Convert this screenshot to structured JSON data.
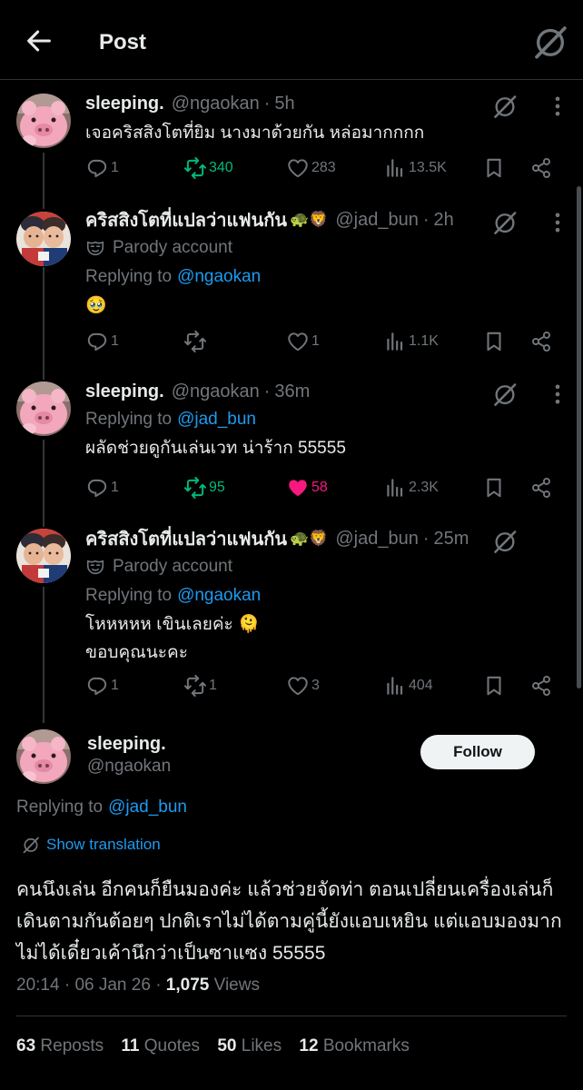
{
  "header": {
    "title": "Post"
  },
  "thread": [
    {
      "avatar": "pink-plush-avatar",
      "name": "sleeping.",
      "handle": "@ngaokan",
      "time": "5h",
      "parody": "",
      "replying_to_label": "",
      "replying_to": "",
      "text": "เจอคริสสิงโตที่ยิม นางมาด้วยกัน หล่อมากกกก",
      "replies": "1",
      "reposts": "340",
      "likes": "283",
      "views": "13.5K",
      "reposted": true,
      "liked": false
    },
    {
      "avatar": "couple-photo-avatar",
      "name": "คริสสิงโตที่แปลว่าแฟนกัน",
      "name_emoji": "🐢🦁",
      "handle": "@jad_bun",
      "time": "2h",
      "parody": "Parody account",
      "replying_to_label": "Replying to",
      "replying_to": "@ngaokan",
      "text": "🥹",
      "replies": "1",
      "reposts": "",
      "likes": "1",
      "views": "1.1K",
      "reposted": false,
      "liked": false
    },
    {
      "avatar": "pink-plush-avatar",
      "name": "sleeping.",
      "handle": "@ngaokan",
      "time": "36m",
      "parody": "",
      "replying_to_label": "Replying to",
      "replying_to": "@jad_bun",
      "text": "ผลัดช่วยดูกันเล่นเวท น่าร้าก 55555",
      "replies": "1",
      "reposts": "95",
      "likes": "58",
      "views": "2.3K",
      "reposted": true,
      "liked": true
    },
    {
      "avatar": "couple-photo-avatar",
      "name": "คริสสิงโตที่แปลว่าแฟนกัน",
      "name_emoji": "🐢🦁",
      "handle": "@jad_bun",
      "time": "25m",
      "parody": "Parody account",
      "replying_to_label": "Replying to",
      "replying_to": "@ngaokan",
      "text_line1": "โหหหหห เขินเลยค่ะ 🫠",
      "text_line2": "ขอบคุณนะคะ",
      "replies": "1",
      "reposts": "1",
      "likes": "3",
      "views": "404",
      "reposted": false,
      "liked": false
    }
  ],
  "main": {
    "name": "sleeping.",
    "handle": "@ngaokan",
    "follow_label": "Follow",
    "replying_to_label": "Replying to",
    "replying_to": "@jad_bun",
    "show_translation": "Show translation",
    "text": "คนนึงเล่น อีกคนก็ยืนมองค่ะ แล้วช่วยจัดท่า ตอนเปลี่ยนเครื่องเล่นก็เดินตามกันต้อยๆ ปกติเราไม่ได้ตามคู่นี้ยังแอบเหยิน แต่แอบมองมากไม่ได้เดี๋ยวเค้านึกว่าเป็นซาแซง 55555",
    "time": "20:14",
    "date": "06 Jan 26",
    "views_count": "1,075",
    "views_label": "Views",
    "reposts_count": "63",
    "reposts_label": "Reposts",
    "quotes_count": "11",
    "quotes_label": "Quotes",
    "likes_count": "50",
    "likes_label": "Likes",
    "bookmarks_count": "12",
    "bookmarks_label": "Bookmarks"
  },
  "colors": {
    "background": "#000000",
    "text": "#e7e9ea",
    "muted": "#71767b",
    "link": "#1d9bf0",
    "repost_active": "#00ba7c",
    "like_active": "#f91880",
    "divider": "#2f3336"
  }
}
